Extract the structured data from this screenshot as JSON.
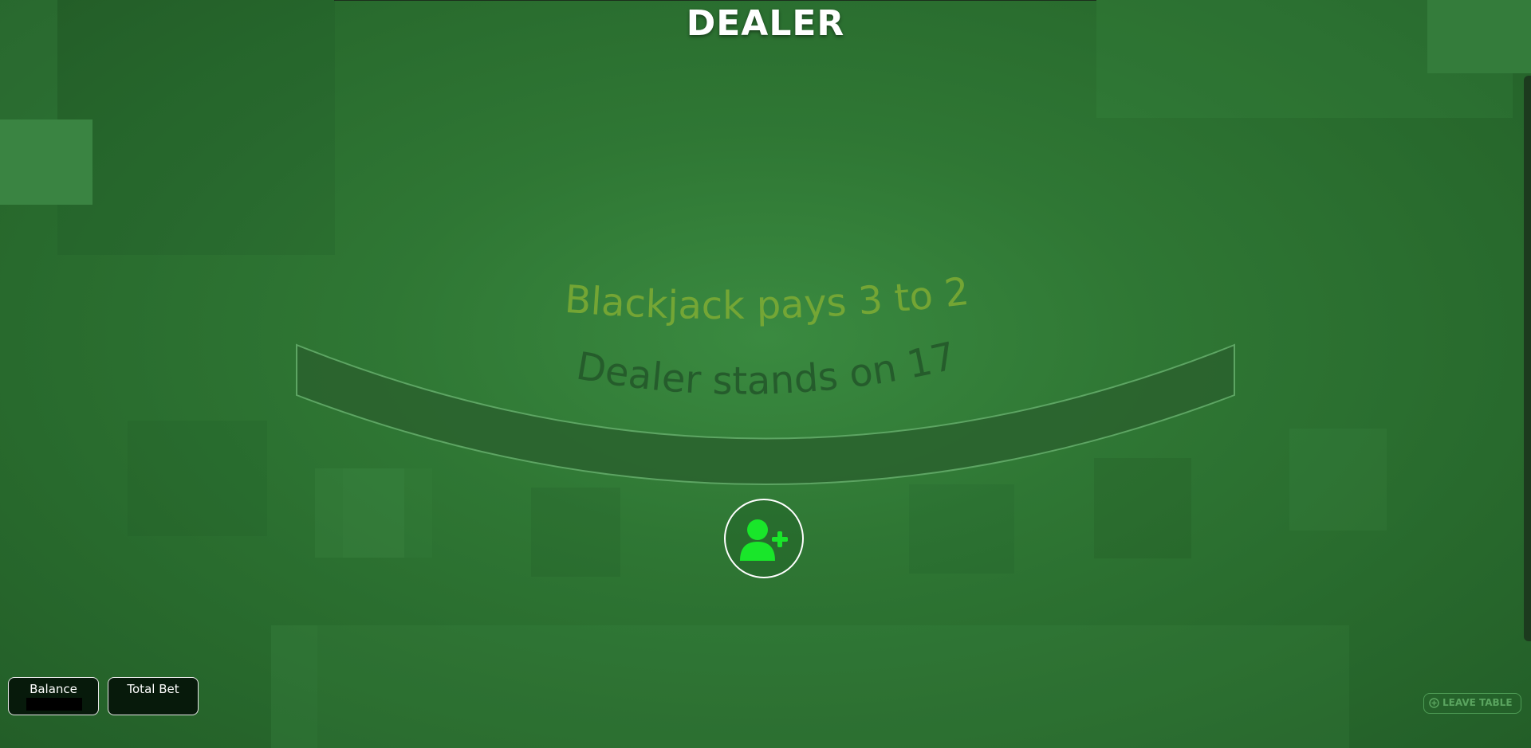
{
  "table": {
    "dealer_label": "DEALER",
    "rule_line_1": "Blackjack pays 3 to 2",
    "rule_line_2": "Dealer stands on 17"
  },
  "seat": {
    "icon": "user-plus-icon",
    "icon_color": "#19e62a"
  },
  "hud": {
    "balance_label": "Balance",
    "balance_value": "",
    "total_bet_label": "Total Bet",
    "total_bet_value": ""
  },
  "leave": {
    "label": "LEAVE TABLE",
    "icon": "circle-plus-icon"
  },
  "colors": {
    "felt": "#2f7734",
    "rule_text_1": "#7fab34",
    "rule_text_2": "#23582a",
    "seat_accent": "#19e62a",
    "panel_bg": "#071a0b"
  }
}
